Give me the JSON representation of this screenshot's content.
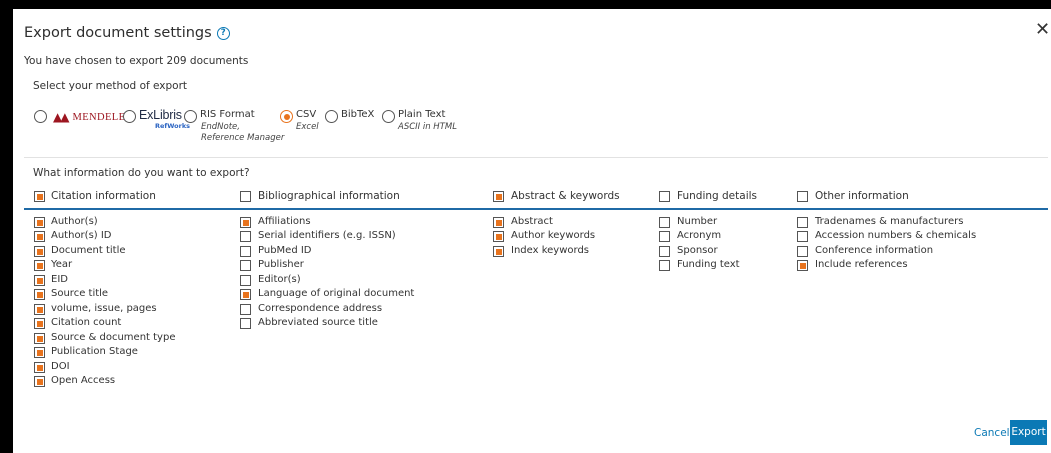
{
  "dialog": {
    "title": "Export document settings",
    "help_icon": "?",
    "close_icon": "✕",
    "subtitle": "You have chosen to export 209 documents",
    "method_label": "Select your method of export",
    "methods": {
      "mendeley": {
        "label": "MENDELEY",
        "selected": false
      },
      "refworks": {
        "label": "ExLibris",
        "sublabel": "RefWorks",
        "selected": false
      },
      "ris": {
        "label": "RIS Format",
        "sub1": "EndNote,",
        "sub2": "Reference Manager",
        "selected": false
      },
      "csv": {
        "label": "CSV",
        "sub1": "Excel",
        "selected": true
      },
      "bibtex": {
        "label": "BibTeX",
        "selected": false
      },
      "plaintext": {
        "label": "Plain Text",
        "sub1": "ASCII in HTML",
        "selected": false
      }
    },
    "question": "What information do you want to export?",
    "categories": [
      {
        "label": "Citation information",
        "checked": true
      },
      {
        "label": "Bibliographical information",
        "checked": false
      },
      {
        "label": "Abstract & keywords",
        "checked": true
      },
      {
        "label": "Funding details",
        "checked": false
      },
      {
        "label": "Other information",
        "checked": false
      }
    ],
    "citation_items": [
      {
        "label": "Author(s)",
        "checked": true
      },
      {
        "label": "Author(s) ID",
        "checked": true
      },
      {
        "label": "Document title",
        "checked": true
      },
      {
        "label": "Year",
        "checked": true
      },
      {
        "label": "EID",
        "checked": true
      },
      {
        "label": "Source title",
        "checked": true
      },
      {
        "label": "volume, issue, pages",
        "checked": true
      },
      {
        "label": "Citation count",
        "checked": true
      },
      {
        "label": "Source & document type",
        "checked": true
      },
      {
        "label": "Publication Stage",
        "checked": true
      },
      {
        "label": "DOI",
        "checked": true
      },
      {
        "label": "Open Access",
        "checked": true
      }
    ],
    "biblio_items": [
      {
        "label": "Affiliations",
        "checked": true
      },
      {
        "label": "Serial identifiers (e.g. ISSN)",
        "checked": false
      },
      {
        "label": "PubMed ID",
        "checked": false
      },
      {
        "label": "Publisher",
        "checked": false
      },
      {
        "label": "Editor(s)",
        "checked": false
      },
      {
        "label": "Language of original document",
        "checked": true
      },
      {
        "label": "Correspondence address",
        "checked": false
      },
      {
        "label": "Abbreviated source title",
        "checked": false
      }
    ],
    "abstract_items": [
      {
        "label": "Abstract",
        "checked": true
      },
      {
        "label": "Author keywords",
        "checked": true
      },
      {
        "label": "Index keywords",
        "checked": true
      }
    ],
    "funding_items": [
      {
        "label": "Number",
        "checked": false
      },
      {
        "label": "Acronym",
        "checked": false
      },
      {
        "label": "Sponsor",
        "checked": false
      },
      {
        "label": "Funding text",
        "checked": false
      }
    ],
    "other_items": [
      {
        "label": "Tradenames & manufacturers",
        "checked": false
      },
      {
        "label": "Accession numbers & chemicals",
        "checked": false
      },
      {
        "label": "Conference information",
        "checked": false
      },
      {
        "label": "Include references",
        "checked": true
      }
    ],
    "cancel_label": "Cancel",
    "export_label": "Export",
    "accent_color": "#e8731d",
    "primary_color": "#0b79b5"
  }
}
